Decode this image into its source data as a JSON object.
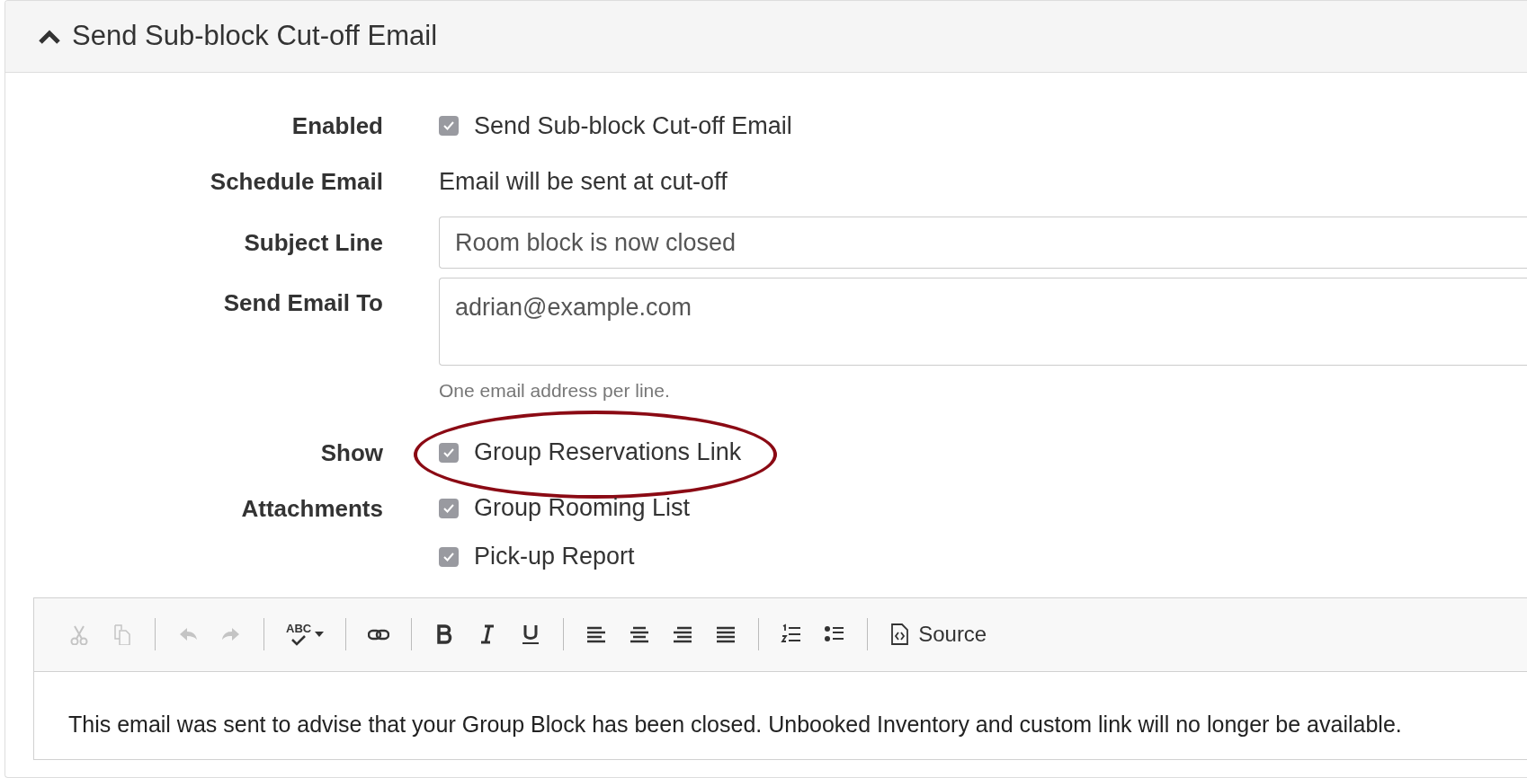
{
  "panel": {
    "title": "Send Sub-block Cut-off Email",
    "expanded": true
  },
  "rows": [
    {
      "label": "Enabled",
      "kind": "checkboxes",
      "options": [
        {
          "label": "Send Sub-block Cut-off Email",
          "checked": true,
          "circled": false
        }
      ]
    },
    {
      "label": "Schedule Email",
      "kind": "text",
      "value": "Email will be sent at cut-off"
    },
    {
      "label": "Subject Line",
      "kind": "input",
      "value": "Room block is now closed"
    },
    {
      "label": "Send Email To",
      "kind": "textarea",
      "value": "adrian@example.com",
      "help": "One email address per line."
    },
    {
      "label": "Show",
      "kind": "checkboxes",
      "options": [
        {
          "label": "Group Reservations Link",
          "checked": true,
          "circled": true
        }
      ]
    },
    {
      "label": "Attachments",
      "kind": "checkboxes",
      "options": [
        {
          "label": "Group Rooming List",
          "checked": true,
          "circled": false
        },
        {
          "label": "Pick-up Report",
          "checked": true,
          "circled": false
        }
      ]
    }
  ],
  "editor": {
    "toolbar": [
      [
        {
          "kind": "cut",
          "disabled": true
        },
        {
          "kind": "copy",
          "disabled": true
        }
      ],
      [
        {
          "kind": "undo",
          "disabled": true
        },
        {
          "kind": "redo",
          "disabled": true
        }
      ],
      [
        {
          "kind": "spellcheck",
          "disabled": false,
          "label": "ABC"
        }
      ],
      [
        {
          "kind": "link",
          "disabled": false
        }
      ],
      [
        {
          "kind": "bold",
          "disabled": false
        },
        {
          "kind": "italic",
          "disabled": false
        },
        {
          "kind": "underline",
          "disabled": false
        }
      ],
      [
        {
          "kind": "align-left",
          "disabled": false
        },
        {
          "kind": "align-center",
          "disabled": false
        },
        {
          "kind": "align-right",
          "disabled": false
        },
        {
          "kind": "justify",
          "disabled": false
        }
      ],
      [
        {
          "kind": "numbered-list",
          "disabled": false
        },
        {
          "kind": "bulleted-list",
          "disabled": false
        }
      ],
      [
        {
          "kind": "source",
          "disabled": false,
          "label": "Source"
        }
      ]
    ],
    "content": "This email was sent to advise that your Group Block has been closed. Unbooked Inventory and custom link will no longer be available."
  }
}
